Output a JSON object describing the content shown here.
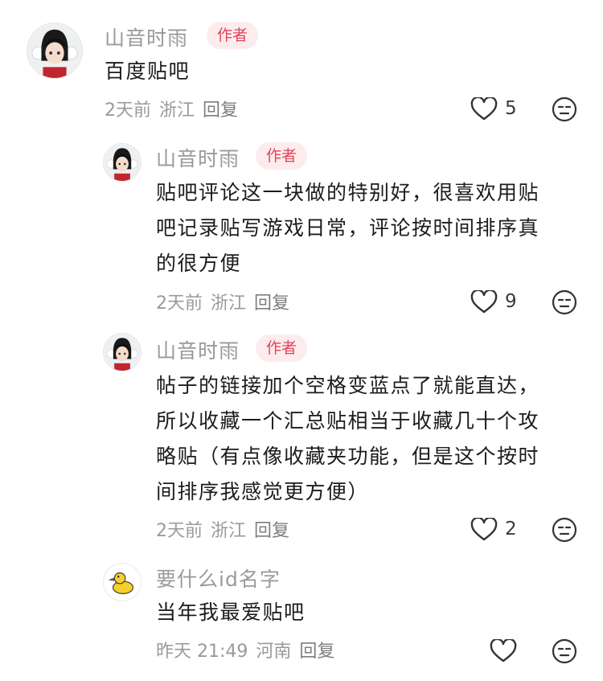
{
  "comments": [
    {
      "user": "山音时雨",
      "badge": "作者",
      "lines": [
        "百度贴吧"
      ],
      "time": "2天前",
      "region": "浙江",
      "reply": "回复",
      "likes": "5",
      "avatar": "anime-girl-avatar"
    },
    {
      "user": "山音时雨",
      "badge": "作者",
      "lines": [
        "贴吧评论这一块做的特别好，很喜欢用贴",
        "吧记录贴写游戏日常，评论按时间排序真",
        "的很方便"
      ],
      "time": "2天前",
      "region": "浙江",
      "reply": "回复",
      "likes": "9",
      "avatar": "anime-girl-avatar"
    },
    {
      "user": "山音时雨",
      "badge": "作者",
      "lines": [
        "帖子的链接加个空格变蓝点了就能直达，",
        "所以收藏一个汇总贴相当于收藏几十个攻",
        "略贴（有点像收藏夹功能，但是这个按时",
        "间排序我感觉更方便）"
      ],
      "time": "2天前",
      "region": "浙江",
      "reply": "回复",
      "likes": "2",
      "avatar": "anime-girl-avatar"
    },
    {
      "user": "要什么id名字",
      "badge": "",
      "lines": [
        "当年我最爱贴吧"
      ],
      "time": "昨天 21:49",
      "region": "河南",
      "reply": "回复",
      "likes": "",
      "avatar": "yellow-duck-avatar"
    }
  ],
  "icons": {
    "like": "heart-icon",
    "dislike": "unamused-face-icon"
  }
}
